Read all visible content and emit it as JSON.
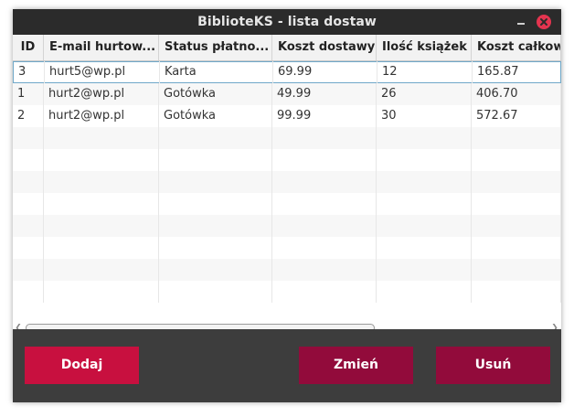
{
  "window": {
    "title": "BiblioteKS - lista dostaw"
  },
  "table": {
    "columns": [
      "ID",
      "E-mail hurtow...",
      "Status płatno...",
      "Koszt dostawy",
      "Ilość książek",
      "Koszt całkow"
    ],
    "rows": [
      [
        "3",
        "hurt5@wp.pl",
        "Karta",
        "69.99",
        "12",
        "165.87"
      ],
      [
        "1",
        "hurt2@wp.pl",
        "Gotówka",
        "49.99",
        "26",
        "406.70"
      ],
      [
        "2",
        "hurt2@wp.pl",
        "Gotówka",
        "99.99",
        "30",
        "572.67"
      ]
    ],
    "selected_row": 0,
    "empty_rows": 8
  },
  "buttons": {
    "add_label": "Dodaj",
    "edit_label": "Zmień",
    "delete_label": "Usuń"
  },
  "icons": {
    "minimize": "minimize-icon",
    "close": "close-icon",
    "scroll_left": "chevron-left-icon",
    "scroll_right": "chevron-right-icon"
  },
  "colors": {
    "add_button": "#c8103f",
    "edit_button": "#920b3b",
    "delete_button": "#920b3b",
    "close_button": "#e4344f",
    "selection_border": "#6fa8c9",
    "window_bg": "#3d3d3d"
  }
}
